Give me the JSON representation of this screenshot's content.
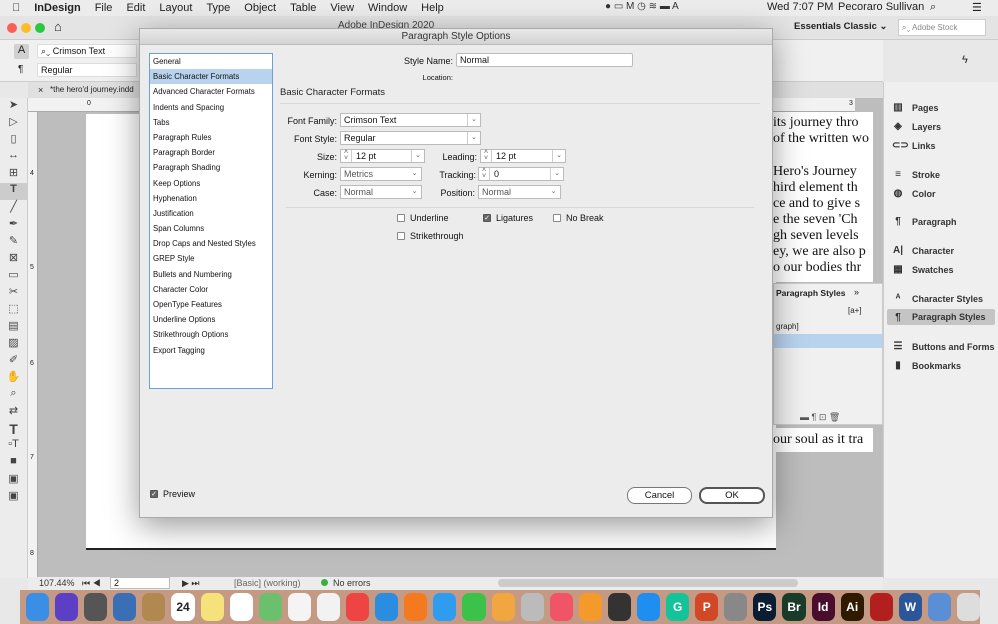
{
  "menubar": {
    "app": "InDesign",
    "items": [
      "File",
      "Edit",
      "Layout",
      "Type",
      "Object",
      "Table",
      "View",
      "Window",
      "Help"
    ],
    "clock": "Wed 7:07 PM",
    "user": "Pecoraro Sullivan"
  },
  "window": {
    "title": "Adobe InDesign 2020",
    "workspace": "Essentials Classic",
    "stock_placeholder": "Adobe Stock"
  },
  "control": {
    "font": "Crimson Text",
    "style": "Regular"
  },
  "document": {
    "tab": "*the hero'd journey.indd",
    "ruler": [
      "0",
      "3"
    ],
    "vruler": [
      "4",
      "5",
      "6",
      "7",
      "8"
    ],
    "lines": [
      "its journey thro",
      "of the written wo",
      "Hero's Journey",
      "hird element th",
      "ce and to give s",
      "e the seven 'Ch",
      "gh seven levels",
      "ey, we are also p",
      "o our bodies thr",
      "our soul as it tra"
    ]
  },
  "side_panel": {
    "title": "Paragraph Styles",
    "item": "[Basic Paragraph]",
    "item_visible": "graph]"
  },
  "dock_panels": [
    {
      "label": "Pages",
      "icon": "pages-icon"
    },
    {
      "label": "Layers",
      "icon": "layers-icon"
    },
    {
      "label": "Links",
      "icon": "links-icon"
    },
    {
      "label": "Stroke",
      "icon": "stroke-icon"
    },
    {
      "label": "Color",
      "icon": "color-icon"
    },
    {
      "label": "Paragraph",
      "icon": "paragraph-icon"
    },
    {
      "label": "Character",
      "icon": "character-icon"
    },
    {
      "label": "Swatches",
      "icon": "swatches-icon"
    },
    {
      "label": "Character Styles",
      "icon": "character-styles-icon"
    },
    {
      "label": "Paragraph Styles",
      "icon": "paragraph-styles-icon",
      "selected": true
    },
    {
      "label": "Buttons and Forms",
      "icon": "buttons-forms-icon"
    },
    {
      "label": "Bookmarks",
      "icon": "bookmarks-icon"
    }
  ],
  "status": {
    "zoom": "107.44%",
    "page": "2",
    "preflight_profile": "[Basic] (working)",
    "errors": "No errors"
  },
  "dialog": {
    "title": "Paragraph Style Options",
    "categories": [
      "General",
      "Basic Character Formats",
      "Advanced Character Formats",
      "Indents and Spacing",
      "Tabs",
      "Paragraph Rules",
      "Paragraph Border",
      "Paragraph Shading",
      "Keep Options",
      "Hyphenation",
      "Justification",
      "Span Columns",
      "Drop Caps and Nested Styles",
      "GREP Style",
      "Bullets and Numbering",
      "Character Color",
      "OpenType Features",
      "Underline Options",
      "Strikethrough Options",
      "Export Tagging"
    ],
    "selected_category": "Basic Character Formats",
    "style_name_label": "Style Name:",
    "style_name": "Normal",
    "location_label": "Location:",
    "section_title": "Basic Character Formats",
    "font_family_label": "Font Family:",
    "font_family": "Crimson Text",
    "font_style_label": "Font Style:",
    "font_style": "Regular",
    "size_label": "Size:",
    "size": "12 pt",
    "leading_label": "Leading:",
    "leading": "12 pt",
    "kerning_label": "Kerning:",
    "kerning": "Metrics",
    "tracking_label": "Tracking:",
    "tracking": "0",
    "case_label": "Case:",
    "case": "Normal",
    "position_label": "Position:",
    "position": "Normal",
    "underline_label": "Underline",
    "underline": false,
    "ligatures_label": "Ligatures",
    "ligatures": true,
    "nobreak_label": "No Break",
    "nobreak": false,
    "strikethrough_label": "Strikethrough",
    "strikethrough": false,
    "preview_label": "Preview",
    "preview": true,
    "cancel": "Cancel",
    "ok": "OK"
  },
  "macdock": [
    "Finder",
    "Siri",
    "Launchpad",
    "Preview",
    "Contacts",
    "Calendar",
    "Notes",
    "Reminders",
    "Maps",
    "TextEdit",
    "Photos",
    "Chrome",
    "Safari",
    "Firefox",
    "Messages",
    "FaceTime",
    "Pages",
    "Fontbook",
    "Music",
    "Books",
    "Pixelmator",
    "App Store",
    "Grammarly",
    "PowerPoint",
    "System Preferences",
    "Photoshop",
    "Bridge",
    "InDesign",
    "Illustrator",
    "Acrobat",
    "Word",
    "Preview2",
    "Trash"
  ],
  "calendar_day": "24"
}
